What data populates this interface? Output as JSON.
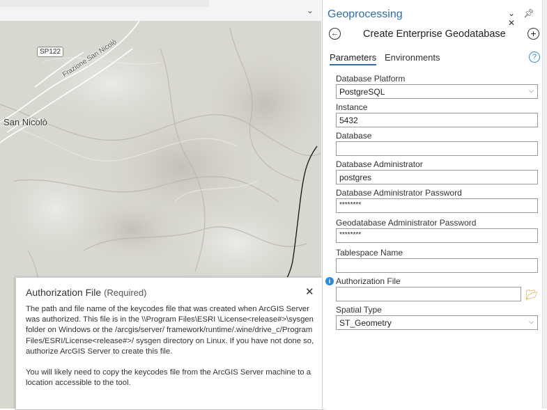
{
  "map": {
    "road_badge": "SP122",
    "road_label": "Frazione San Nicolò",
    "place_label": "San Nicolò",
    "chevron_icon": "chevron-down-icon"
  },
  "popup": {
    "title": "Authorization File",
    "required_note": "(Required)",
    "close_glyph": "✕",
    "paragraphs": [
      "The path and file name of the keycodes file that was created when ArcGIS Server was authorized. This file is in the \\\\Program Files\\ESRI \\License<release#>\\sysgen folder on Windows or the /arcgis/server/ framework/runtime/.wine/drive_c/Program Files/ESRI/License<release#>/ sysgen directory on Linux. If you have not done so, authorize ArcGIS Server to create this file.",
      "You will likely need to copy the keycodes file from the ArcGIS Server machine to a location accessible to the tool."
    ]
  },
  "pane": {
    "title": "Geoprocessing",
    "tool_name": "Create Enterprise Geodatabase",
    "tabs": [
      "Parameters",
      "Environments"
    ],
    "help_glyph": "?",
    "window_icons": [
      "chevron-down-icon",
      "pin-icon",
      "close-icon"
    ],
    "accent": "#2c6fb5"
  },
  "params": {
    "database_platform": {
      "label": "Database Platform",
      "value": "PostgreSQL"
    },
    "instance": {
      "label": "Instance",
      "value": "5432"
    },
    "database": {
      "label": "Database",
      "value": ""
    },
    "db_admin": {
      "label": "Database Administrator",
      "value": "postgres"
    },
    "db_admin_pw": {
      "label": "Database Administrator Password",
      "value": "********"
    },
    "gdb_admin_pw": {
      "label": "Geodatabase Administrator Password",
      "value": "********"
    },
    "tablespace": {
      "label": "Tablespace Name",
      "value": ""
    },
    "auth_file": {
      "label": "Authorization File",
      "value": ""
    },
    "spatial_type": {
      "label": "Spatial Type",
      "value": "ST_Geometry"
    }
  }
}
